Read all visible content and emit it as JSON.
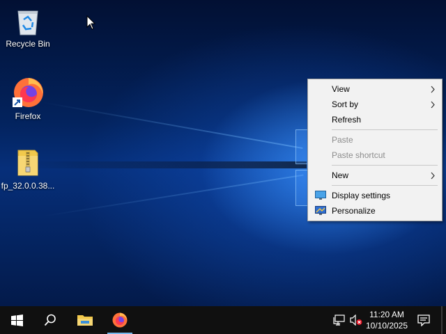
{
  "desktop": {
    "icons": [
      {
        "label": "Recycle Bin",
        "icon": "recycle-bin-icon"
      },
      {
        "label": "Firefox",
        "icon": "firefox-icon"
      },
      {
        "label": "fp_32.0.0.38...",
        "icon": "zip-folder-icon"
      }
    ]
  },
  "context_menu": {
    "items": {
      "view": "View",
      "sort_by": "Sort by",
      "refresh": "Refresh",
      "paste": "Paste",
      "paste_shortcut": "Paste shortcut",
      "new": "New",
      "display_settings": "Display settings",
      "personalize": "Personalize"
    }
  },
  "taskbar": {
    "pinned": [
      "windows-start-icon",
      "search-icon",
      "file-explorer-icon",
      "firefox-icon"
    ],
    "tray": [
      "network-icon",
      "volume-muted-icon",
      "action-center-icon"
    ],
    "time": "11:20 AM",
    "date": "10/10/2025"
  },
  "colors": {
    "taskbar_bg": "#101010",
    "menu_bg": "#f2f2f2",
    "accent": "#0078d7"
  }
}
